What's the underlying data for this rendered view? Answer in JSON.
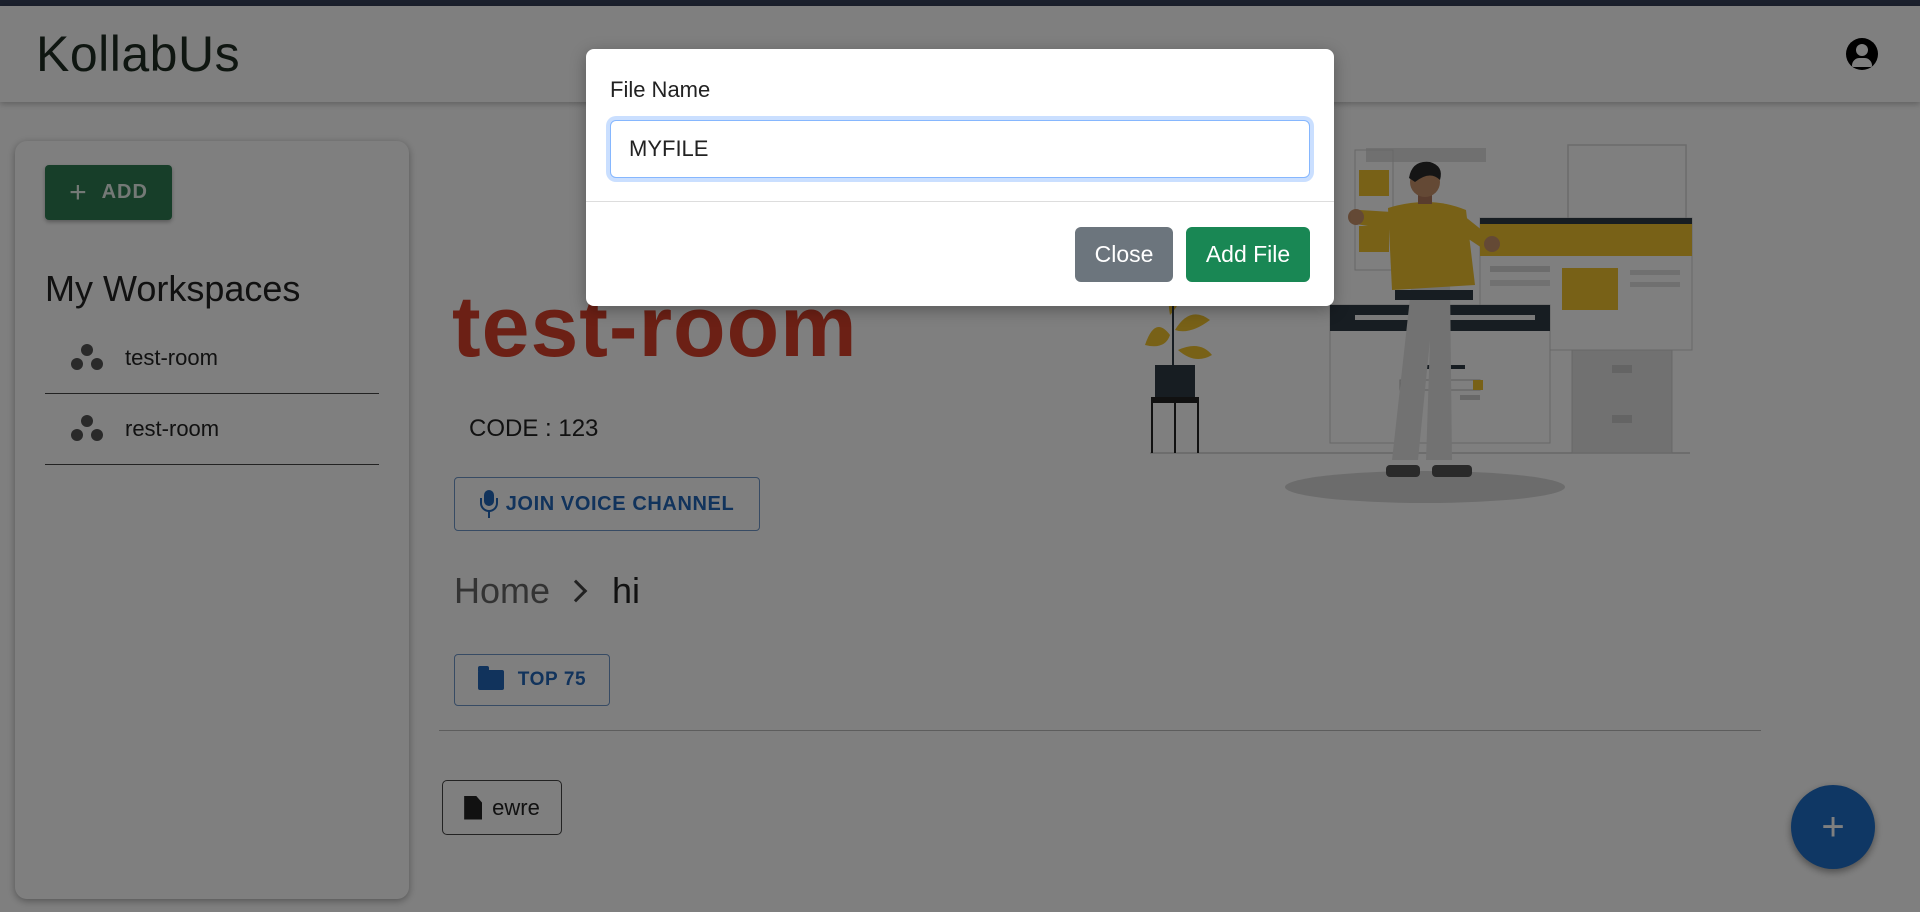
{
  "app": {
    "title": "KollabUs"
  },
  "sidebar": {
    "add_label": "ADD",
    "workspaces_title": "My Workspaces",
    "workspaces": [
      {
        "label": "test-room"
      },
      {
        "label": "rest-room"
      }
    ]
  },
  "room": {
    "title": "test-room",
    "code": "CODE : 123",
    "voice_label": "JOIN VOICE CHANNEL",
    "breadcrumb": {
      "home": "Home",
      "current": "hi"
    },
    "folder_label": "TOP 75",
    "files": [
      {
        "name": "ewre"
      }
    ]
  },
  "modal": {
    "label": "File Name",
    "input_value": "MYFILE",
    "close_label": "Close",
    "add_label": "Add File"
  },
  "icons": {
    "account": "account-circle-icon",
    "plus": "plus-icon",
    "group": "group-icon",
    "mic": "mic-icon",
    "folder": "folder-icon",
    "file": "file-icon",
    "chevron": "chevron-right-icon"
  },
  "colors": {
    "primary_green": "#2e7d52",
    "room_title": "#d9402a",
    "accent_blue": "#2266b8",
    "fab": "#1f6fc8",
    "modal_add": "#198754",
    "modal_close": "#6c757d"
  }
}
